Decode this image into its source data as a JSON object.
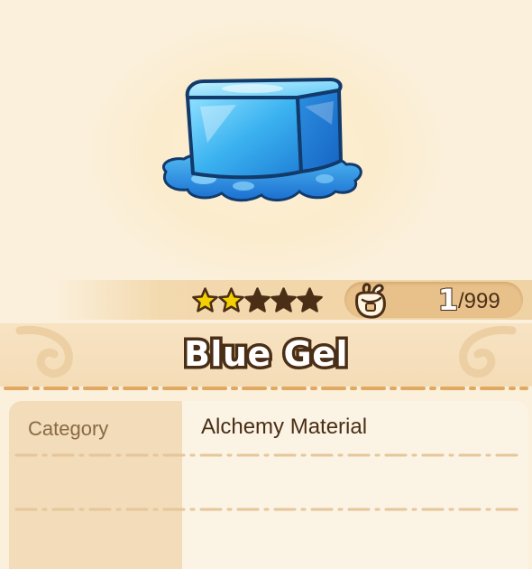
{
  "item": {
    "name": "Blue Gel",
    "rarity_stars": 2,
    "max_stars": 5,
    "icon": "blue-gel-cube",
    "accent_color": "#3aa9ee"
  },
  "inventory": {
    "icon": "item-bag-icon",
    "current": "1",
    "max": "/999"
  },
  "details": {
    "rows": [
      {
        "label": "Category",
        "value": "Alchemy Material"
      }
    ]
  },
  "colors": {
    "background": "#fbf0dc",
    "text_dark": "#4a2e16",
    "label_text": "#8a6a45",
    "star_filled": "#f5d000",
    "star_empty": "#4a2e16",
    "pill": "#e8c08a"
  }
}
